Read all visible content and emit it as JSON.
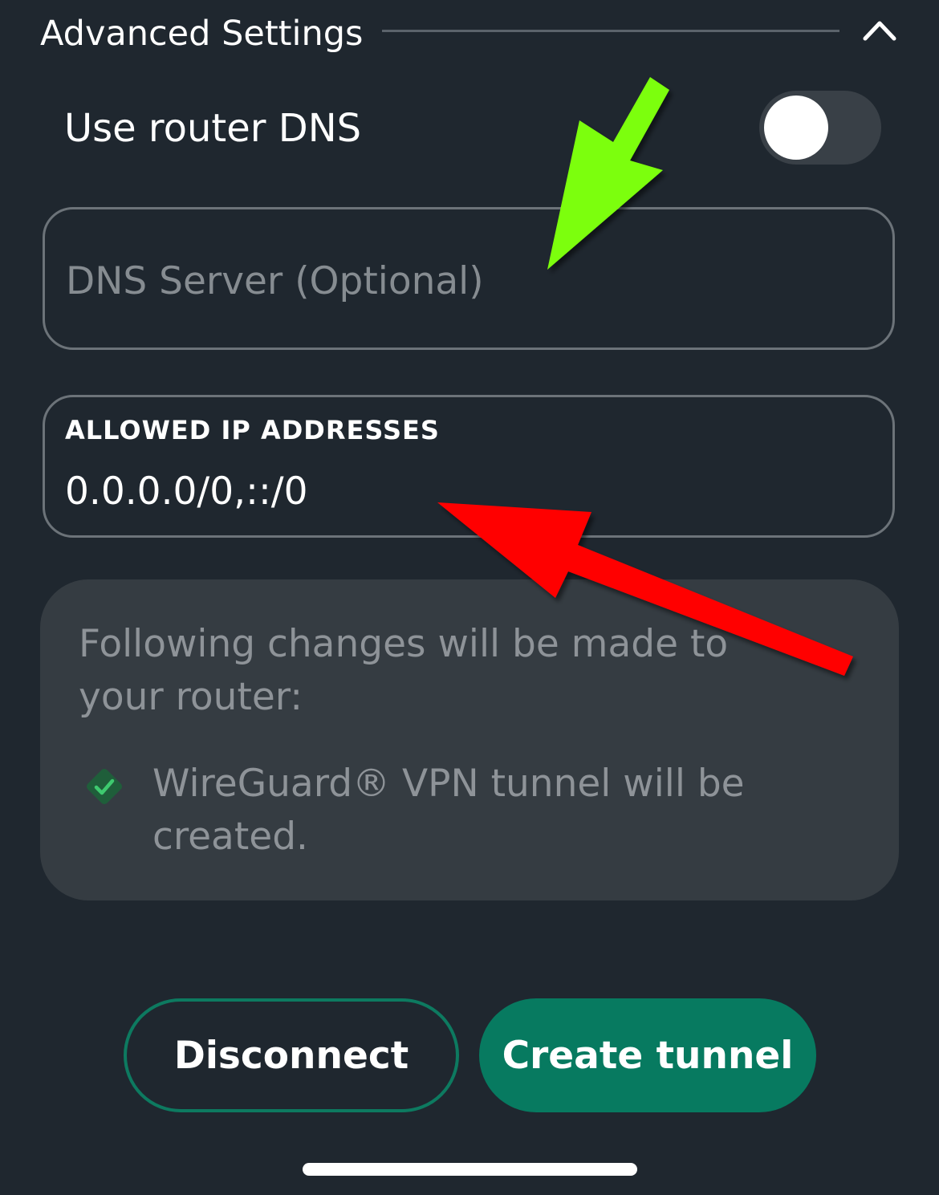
{
  "advanced_settings": {
    "title": "Advanced Settings",
    "collapse_icon": "chevron-up-icon"
  },
  "router_dns": {
    "label": "Use router DNS",
    "enabled": false
  },
  "dns_server": {
    "placeholder": "DNS Server (Optional)",
    "value": ""
  },
  "allowed_ips": {
    "label": "ALLOWED IP ADDRESSES",
    "value": "0.0.0.0/0,::/0"
  },
  "changes_info": {
    "heading": "Following changes will be made to your router:",
    "items": [
      {
        "icon": "check-diamond-icon",
        "text": "WireGuard® VPN tunnel will be created."
      }
    ]
  },
  "actions": {
    "disconnect_label": "Disconnect",
    "create_label": "Create tunnel"
  },
  "colors": {
    "background": "#1f272f",
    "card": "#353c42",
    "accent": "#077a60",
    "check": "#3ec96f",
    "annotation_green": "#7cff0a",
    "annotation_red": "#ff0000"
  }
}
